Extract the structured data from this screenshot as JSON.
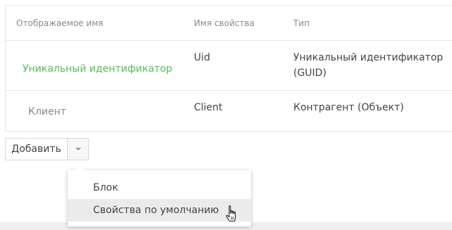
{
  "table": {
    "columns": [
      "Отображаемое имя",
      "Имя свойства",
      "Тип"
    ],
    "rows": [
      {
        "display_name": "Уникальный идентификатор",
        "property_name": "Uid",
        "type_line1": "Уникальный идентификатор",
        "type_line2": "(GUID)"
      },
      {
        "display_name": "Клиент",
        "property_name": "Client",
        "type_line1": "Контрагент (Объект)",
        "type_line2": ""
      }
    ]
  },
  "toolbar": {
    "add_label": "Добавить",
    "caret_icon": "chevron-down-icon"
  },
  "dropdown": {
    "items": [
      "Блок",
      "Свойства по умолчанию"
    ]
  },
  "colors": {
    "link_green": "#5cb85c",
    "header_gray": "#8a8a8a",
    "highlight": "#ebebeb"
  },
  "cursor_icon": "hand-pointer-icon"
}
